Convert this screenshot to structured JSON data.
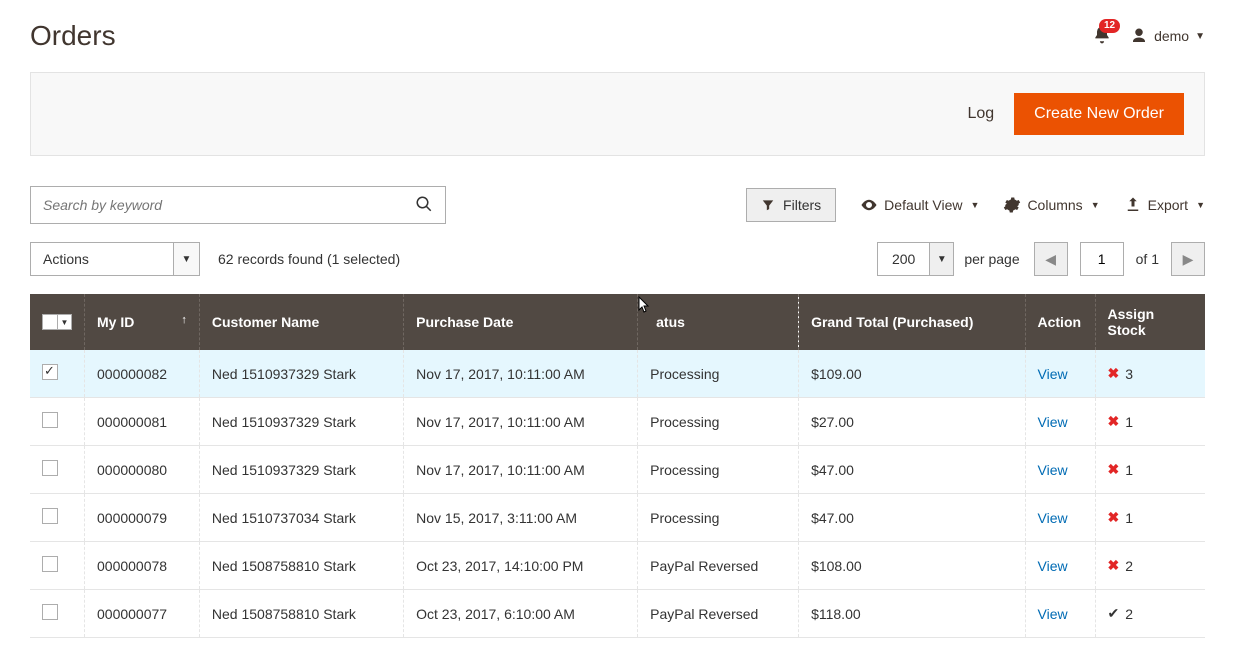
{
  "header": {
    "title": "Orders",
    "notification_count": "12",
    "user_name": "demo"
  },
  "action_bar": {
    "log_label": "Log",
    "create_label": "Create New Order"
  },
  "search": {
    "placeholder": "Search by keyword"
  },
  "toolbar": {
    "filters_label": "Filters",
    "default_view_label": "Default View",
    "columns_label": "Columns",
    "export_label": "Export"
  },
  "grid_controls": {
    "actions_label": "Actions",
    "records_found_text": "62 records found (1 selected)",
    "per_page_value": "200",
    "per_page_label": "per page",
    "current_page": "1",
    "of_text": "of",
    "total_pages": "1"
  },
  "columns": {
    "my_id": "My ID",
    "customer_name": "Customer Name",
    "purchase_date": "Purchase Date",
    "status": "atus",
    "grand_total": "Grand Total (Purchased)",
    "action": "Action",
    "assign_stock": "Assign Stock"
  },
  "view_label": "View",
  "rows": [
    {
      "selected": true,
      "id": "000000082",
      "customer": "Ned 1510937329 Stark",
      "date": "Nov 17, 2017, 10:11:00 AM",
      "status": "Processing",
      "total": "$109.00",
      "assign_icon": "x",
      "assign_count": "3"
    },
    {
      "selected": false,
      "id": "000000081",
      "customer": "Ned 1510937329 Stark",
      "date": "Nov 17, 2017, 10:11:00 AM",
      "status": "Processing",
      "total": "$27.00",
      "assign_icon": "x",
      "assign_count": "1"
    },
    {
      "selected": false,
      "id": "000000080",
      "customer": "Ned 1510937329 Stark",
      "date": "Nov 17, 2017, 10:11:00 AM",
      "status": "Processing",
      "total": "$47.00",
      "assign_icon": "x",
      "assign_count": "1"
    },
    {
      "selected": false,
      "id": "000000079",
      "customer": "Ned 1510737034 Stark",
      "date": "Nov 15, 2017, 3:11:00 AM",
      "status": "Processing",
      "total": "$47.00",
      "assign_icon": "x",
      "assign_count": "1"
    },
    {
      "selected": false,
      "id": "000000078",
      "customer": "Ned 1508758810 Stark",
      "date": "Oct 23, 2017, 14:10:00 PM",
      "status": "PayPal Reversed",
      "total": "$108.00",
      "assign_icon": "x",
      "assign_count": "2"
    },
    {
      "selected": false,
      "id": "000000077",
      "customer": "Ned 1508758810 Stark",
      "date": "Oct 23, 2017, 6:10:00 AM",
      "status": "PayPal Reversed",
      "total": "$118.00",
      "assign_icon": "check",
      "assign_count": "2"
    }
  ]
}
